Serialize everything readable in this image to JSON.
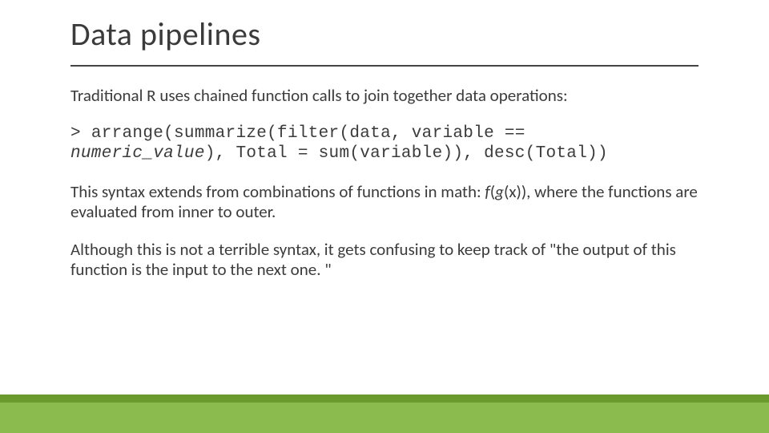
{
  "slide": {
    "title": "Data pipelines",
    "para1": "Traditional R uses chained function calls to join together data operations:",
    "code_line1_prompt": "> ",
    "code_line1_a": "arrange(summarize(filter(data, variable == ",
    "code_line2_italic": "numeric_value",
    "code_line2_b": "), Total = sum(variable)), desc(Total))",
    "para2_a": "This syntax extends from combinations of functions in math: ",
    "para2_f": "f",
    "para2_paren1": "(",
    "para2_g": "g",
    "para2_paren2": "(x)), where the functions are evaluated from inner to outer.",
    "para3": "Although this is not a terrible syntax, it gets confusing to keep track of \"the output of this function is the input to the next one. \""
  }
}
